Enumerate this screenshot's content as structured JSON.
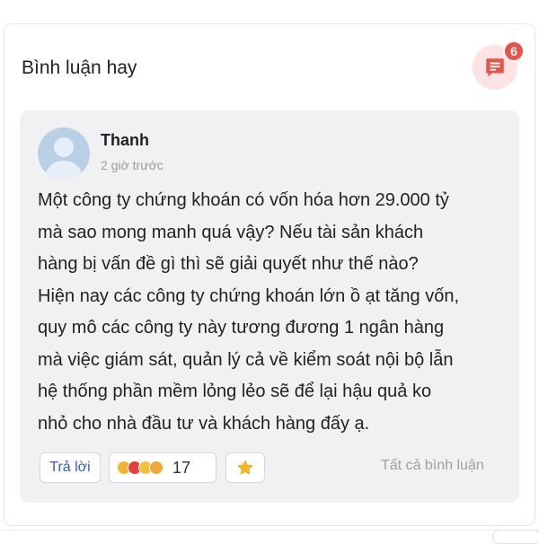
{
  "header": {
    "title": "Bình luận hay",
    "comment_count": "6"
  },
  "comment": {
    "author": "Thanh",
    "time": "2 giờ trước",
    "body_lines": [
      "Một công ty chứng khoán có vốn hóa hơn 29.000 tỷ",
      "mà sao mong manh quá vậy? Nếu tài sản khách",
      "hàng bị vấn đề gì thì sẽ giải quyết như thế nào?",
      "Hiện nay các công ty chứng khoán lớn ồ ạt tăng vốn,",
      "quy mô các công ty này tương đương 1 ngân hàng",
      "mà việc giám sát, quản lý cả về kiểm soát nội bộ lẫn",
      "hệ thống phần mềm lỏng lẻo sẽ để lại hậu quả ko",
      "nhỏ cho nhà đầu tư và khách hàng đấy ạ."
    ],
    "reply_label": "Trả lời",
    "reaction_count": "17",
    "reaction_icons": [
      "like-icon",
      "love-icon",
      "haha-icon",
      "wow-icon"
    ],
    "star_icon": "star-icon",
    "all_comments_label": "Tất cả bình luận"
  },
  "colors": {
    "accent": "#e8534a",
    "link": "#2b62b5",
    "card_bg": "#f1f1f3"
  }
}
